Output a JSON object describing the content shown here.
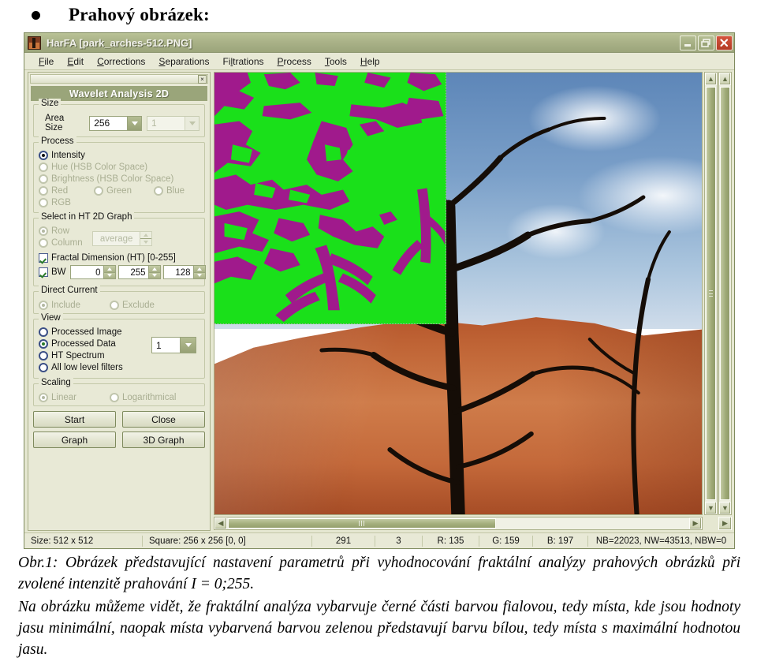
{
  "heading": {
    "bullet_label": "Prahový obrázek:"
  },
  "app": {
    "title": "HarFA [park_arches-512.PNG]",
    "window_buttons": {
      "minimize": "minimize-button",
      "restore": "restore-button",
      "close": "close-button"
    },
    "menu": [
      {
        "pre": "",
        "acc": "F",
        "post": "ile"
      },
      {
        "pre": "",
        "acc": "E",
        "post": "dit"
      },
      {
        "pre": "",
        "acc": "C",
        "post": "orrections"
      },
      {
        "pre": "",
        "acc": "S",
        "post": "eparations"
      },
      {
        "pre": "Fi",
        "acc": "l",
        "post": "trations"
      },
      {
        "pre": "",
        "acc": "P",
        "post": "rocess"
      },
      {
        "pre": "",
        "acc": "T",
        "post": "ools"
      },
      {
        "pre": "",
        "acc": "H",
        "post": "elp"
      }
    ],
    "panel": {
      "title": "Wavelet Analysis 2D",
      "close_glyph": "×",
      "size": {
        "legend": "Size",
        "area_size_label": "Area Size",
        "area_size_value": "256",
        "secondary_value": "1"
      },
      "process": {
        "legend": "Process",
        "options": [
          {
            "label": "Intensity",
            "selected": true,
            "enabled": true
          },
          {
            "label": "Hue (HSB Color Space)",
            "selected": false,
            "enabled": false
          },
          {
            "label": "Brightness (HSB Color Space)",
            "selected": false,
            "enabled": false
          },
          {
            "label": "Red",
            "selected": false,
            "enabled": false
          },
          {
            "label": "Green",
            "selected": false,
            "enabled": false
          },
          {
            "label": "Blue",
            "selected": false,
            "enabled": false
          },
          {
            "label": "RGB",
            "selected": false,
            "enabled": false
          }
        ]
      },
      "select_ht": {
        "legend": "Select in HT 2D Graph",
        "row_label": "Row",
        "column_label": "Column",
        "average_value": "average",
        "fractal_label": "Fractal Dimension (HT) [0-255]",
        "fractal_checked": true,
        "bw_label": "BW",
        "bw_checked": true,
        "bw_min": "0",
        "bw_max": "255",
        "bw_threshold": "128"
      },
      "direct_current": {
        "legend": "Direct Current",
        "include_label": "Include",
        "exclude_label": "Exclude"
      },
      "view": {
        "legend": "View",
        "options": [
          {
            "label": "Processed Image",
            "selected": false
          },
          {
            "label": "Processed Data",
            "selected": true
          },
          {
            "label": "HT Spectrum",
            "selected": false
          },
          {
            "label": "All low level filters",
            "selected": false
          }
        ],
        "index_value": "1"
      },
      "scaling": {
        "legend": "Scaling",
        "linear_label": "Linear",
        "logarithmical_label": "Logarithmical"
      },
      "buttons": {
        "start": "Start",
        "close": "Close",
        "graph": "Graph",
        "graph3d": "3D Graph"
      }
    },
    "statusbar": {
      "size": "Size: 512 x 512",
      "square": "Square: 256 x 256 [0, 0]",
      "value1": "291",
      "value2": "3",
      "r": "R: 135",
      "g": "G: 159",
      "b": "B: 197",
      "counts": "NB=22023, NW=43513, NBW=0"
    },
    "colors": {
      "threshold_green": "#1ae01a",
      "threshold_magenta": "#a01a8c",
      "titlebar": "#9ba57a",
      "panel_header": "#9aa57a",
      "close_button": "#c24a30"
    }
  },
  "caption": {
    "line1": "Obr.1: Obrázek představující nastavení parametrů při vyhodnocování fraktální analýzy prahových obrázků při zvolené intenzitě prahování I = 0;255.",
    "line2": "Na obrázku můžeme vidět, že fraktální analýza vybarvuje černé části barvou fialovou, tedy místa, kde jsou hodnoty jasu minimální, naopak místa vybarvená barvou zelenou představují barvu bílou, tedy místa s maximální hodnotou jasu."
  }
}
